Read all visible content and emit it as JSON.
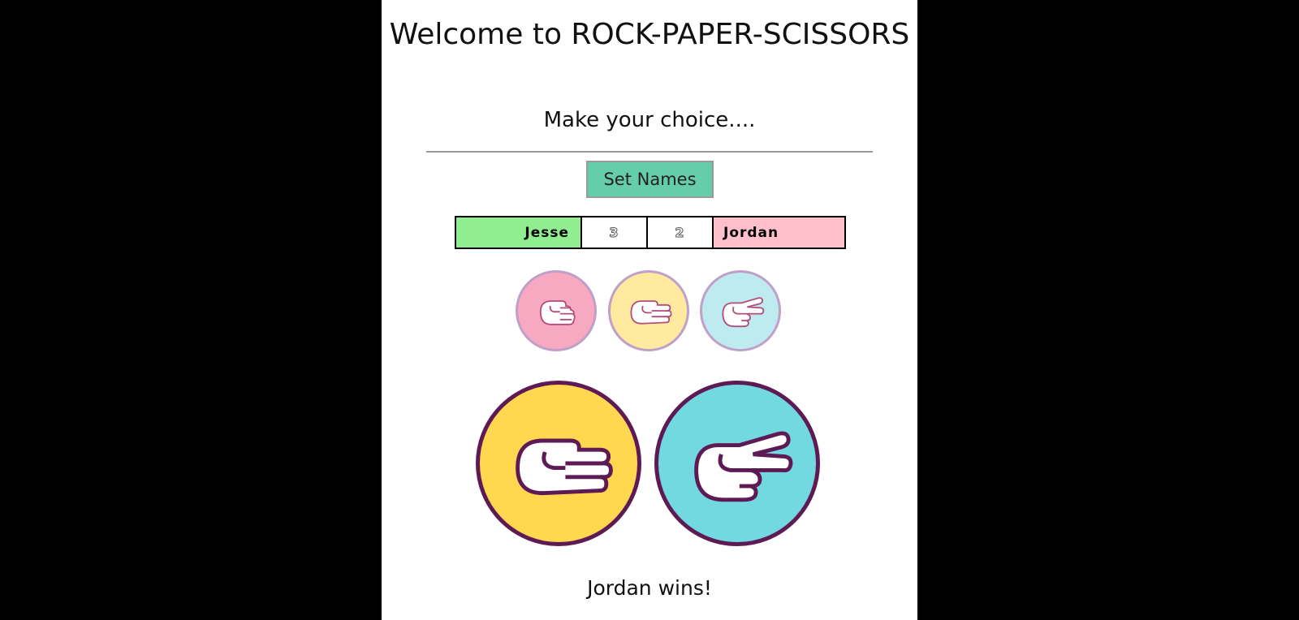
{
  "header": {
    "title": "Welcome to ROCK-PAPER-SCISSORS",
    "subtitle": "Make your choice...."
  },
  "controls": {
    "set_names_label": "Set Names"
  },
  "scoreboard": {
    "player1_name": "Jesse",
    "player1_score": "3",
    "player2_score": "2",
    "player2_name": "Jordan",
    "player1_color": "#90ee90",
    "player2_color": "#ffc0cb"
  },
  "choices": [
    {
      "name": "rock",
      "icon": "rock-hand-icon",
      "color": "#f6a9c0"
    },
    {
      "name": "paper",
      "icon": "paper-hand-icon",
      "color": "#ffeaa0"
    },
    {
      "name": "scissors",
      "icon": "scissors-hand-icon",
      "color": "#bdebf0"
    }
  ],
  "played": {
    "player1_choice": "paper",
    "player1_icon": "paper-hand-icon",
    "player1_color": "#ffd84f",
    "player2_choice": "scissors",
    "player2_icon": "scissors-hand-icon",
    "player2_color": "#72d9e0"
  },
  "result": {
    "text": "Jordan wins!"
  }
}
